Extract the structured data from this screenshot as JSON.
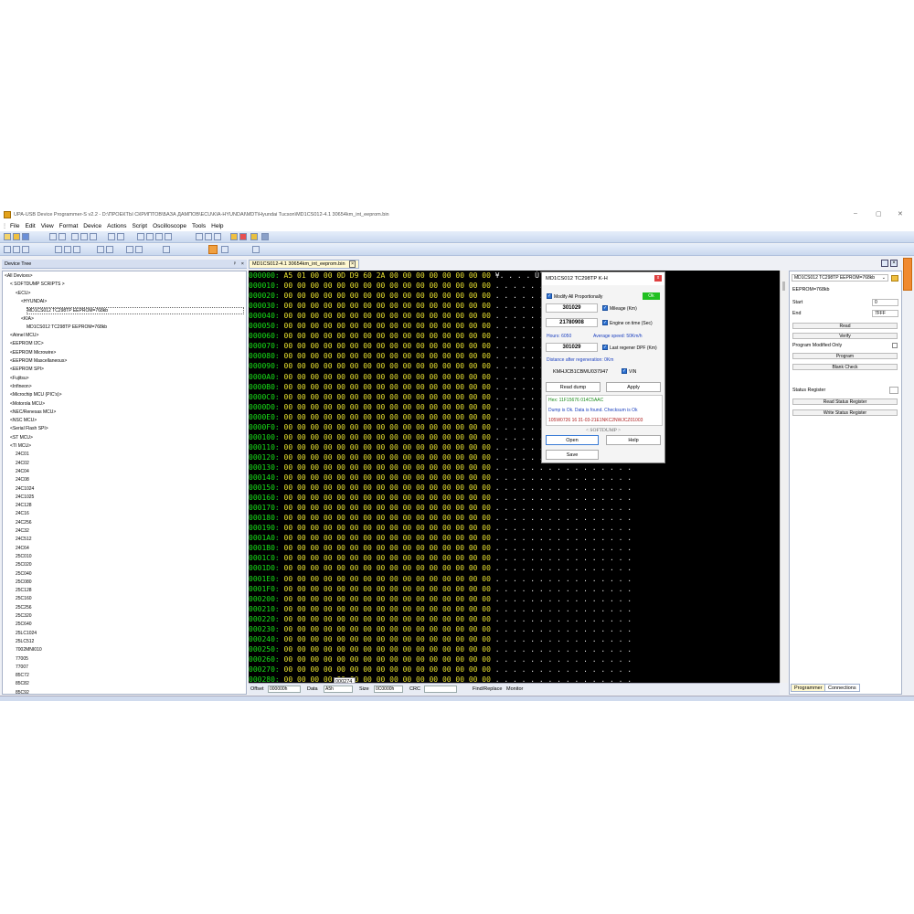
{
  "window": {
    "title": "UPA-USB Device Programmer-S v2.2 - D:\\ПРОЕКТЫ СКРИПТОВ\\БАЗА ДАМПОВ\\ECU\\KIA-HYUNDAI\\MDT\\Hyundai Tucson\\MD1CS012-4.1 30654km_int_eeprom.bin",
    "minimize": "–",
    "maximize": "▢",
    "close": "✕"
  },
  "menu": [
    "File",
    "Edit",
    "View",
    "Format",
    "Device",
    "Actions",
    "Script",
    "Oscilloscope",
    "Tools",
    "Help"
  ],
  "device_tree": {
    "title": "Device Tree",
    "pin": "ᵖ",
    "close": "×",
    "items": [
      "<All Devices>",
      "< SOFTDUMP SCRIPTS >",
      "<ECU>",
      "<HYUNDAI>",
      "MD1CS012 TC298TP EEPROM=768kb",
      "<KIA>",
      "MD1CS012 TC298TP EEPROM=768kb",
      "<Atmel MCU>",
      "<EEPROM I2C>",
      "<EEPROM Microwire>",
      "<EEPROM Mascellaneous>",
      "<EEPROM SPI>",
      "<Fujitsu>",
      "<Infineon>",
      "<Microchip MCU (PIC's)>",
      "<Motorola MCU>",
      "<NEC/Renesas MCU>",
      "<NSC MCU>",
      "<Serial Flash SPI>",
      "<ST MCU>",
      "<TI MCU>",
      "24C01",
      "24C02",
      "24C04",
      "24C08",
      "24C1024",
      "24C1025",
      "24C128",
      "24C16",
      "24C256",
      "24C32",
      "24C512",
      "24C64",
      "25C010",
      "25C020",
      "25C040",
      "25C080",
      "25C128",
      "25C160",
      "25C256",
      "25C320",
      "25C640",
      "25LC1024",
      "25LC512",
      "7002MNI010",
      "77005",
      "77007",
      "85C72",
      "85C82",
      "85C92"
    ]
  },
  "hex": {
    "tab": "MD1CS012-4.1 30654km_int_eeprom.bin",
    "tab_close": "×",
    "first_bytes": "A5 01 00 00 0D D9 60 2A 00 00 00 00 00 00 00 00",
    "first_ascii": "¥. . . . Ù` *",
    "zero_bytes": "00 00 00 00 00 00 00 00 00 00 00 00 00 00 00 00",
    "dots": ". . . . . . . . . . . . . . . .",
    "offsets": [
      "000000:",
      "000010:",
      "000020:",
      "000030:",
      "000040:",
      "000050:",
      "000060:",
      "000070:",
      "000080:",
      "000090:",
      "0000A0:",
      "0000B0:",
      "0000C0:",
      "0000D0:",
      "0000E0:",
      "0000F0:",
      "000100:",
      "000110:",
      "000120:",
      "000130:",
      "000140:",
      "000150:",
      "000160:",
      "000170:",
      "000180:",
      "000190:",
      "0001A0:",
      "0001B0:",
      "0001C0:",
      "0001D0:",
      "0001E0:",
      "0001F0:",
      "000200:",
      "000210:",
      "000220:",
      "000230:",
      "000240:",
      "000250:",
      "000260:",
      "000270:",
      "000280:"
    ],
    "tooltip": "000274",
    "bottom": {
      "offset_label": "Offset",
      "offset_val": "000000h",
      "data_label": "Data",
      "data_val": "A5h",
      "size_label": "Size",
      "size_val": "0C0000h",
      "crc_label": "CRC",
      "findreplace": "Find/Replace",
      "monitor": "Monitor"
    }
  },
  "dialog": {
    "title": "MD1CS012 TC298TP K-H",
    "close": "x",
    "modify_all": "Modify All Proportionally",
    "ok": "Ok",
    "mileage_val": "301029",
    "mileage_label": "Mileage (Km)",
    "engine_val": "21780908",
    "engine_label": "Engine on time (Sec)",
    "hours": "Hours: 6050",
    "avg_speed": "Average speed: 50Km/h",
    "regen_val": "301029",
    "regen_label": "Last regener DPF (Km)",
    "distance": "Distance after regeneration: 0Km",
    "vin_val": "KMHJCB1CBMU037947",
    "vin_label": "VIN",
    "read_dump": "Read dump",
    "apply": "Apply",
    "hex_line": "Hex: 11F15676 014C5AAC",
    "dump_ok": "Dump is Ok. Data is found. Checksum is Ok",
    "info_line": "105W0726 16 31-03-21E1NKC2NWJCZ01003",
    "softdump": "< SOFTDUMP >",
    "open": "Open",
    "help": "Help",
    "save": "Save"
  },
  "programmer": {
    "device": "MD1CS012 TC298TP EEPROM=768kb",
    "eeprom": "EEPROM=768kb",
    "start_label": "Start",
    "start_val": "0",
    "end_label": "End",
    "end_val": "7FFF",
    "read": "Read",
    "verify": "Verify",
    "prog_modified": "Program Modified Only",
    "program": "Program",
    "blank_check": "Blank Check",
    "status_register": "Status Register",
    "read_status": "Read Status Register",
    "write_status": "Write Status Register",
    "tab_programmer": "Programmer",
    "tab_connections": "Connections"
  },
  "colors": {
    "hex_offset": "#18e018",
    "hex_bytes": "#e8e030",
    "accent": "#f08a30",
    "dialog_green": "#1a8a1a",
    "dialog_blue": "#1a3fbf",
    "dialog_red": "#b02020"
  }
}
